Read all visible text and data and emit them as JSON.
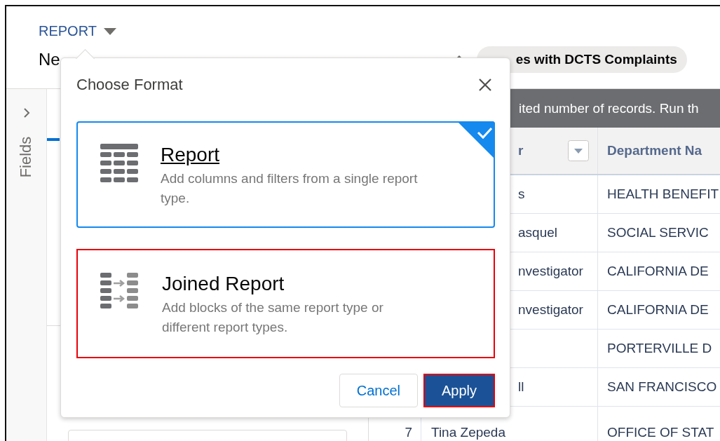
{
  "header": {
    "object_label": "REPORT",
    "title": "Ne",
    "pill": "es with DCTS Complaints"
  },
  "sidebar": {
    "label": "Fields"
  },
  "table": {
    "banner": "ited number of records. Run th",
    "columns": [
      {
        "label": "r"
      },
      {
        "label": "Department Na"
      }
    ],
    "rows": [
      {
        "name": "s",
        "partial": true,
        "department": "HEALTH BENEFIT"
      },
      {
        "name": "asquel",
        "partial": true,
        "department": "SOCIAL SERVIC"
      },
      {
        "name": "nvestigator",
        "partial": true,
        "department": "CALIFORNIA DE"
      },
      {
        "name": "nvestigator",
        "partial": true,
        "department": "CALIFORNIA DE"
      },
      {
        "department": "PORTERVILLE D"
      },
      {
        "name": "ll",
        "partial": true,
        "department": "SAN FRANCISCO"
      },
      {
        "number": "7",
        "name": "Tina Zepeda",
        "partial": false,
        "department": "OFFICE OF STAT"
      }
    ]
  },
  "dialog": {
    "title": "Choose Format",
    "options": [
      {
        "kind": "report",
        "title": "Report",
        "description": "Add columns and filters from a single report type.",
        "selected": true,
        "highlighted": false
      },
      {
        "kind": "joined",
        "title": "Joined Report",
        "description": "Add blocks of the same report type or different report types.",
        "selected": false,
        "highlighted": true
      }
    ],
    "buttons": [
      {
        "label": "Cancel",
        "kind": "neutral",
        "highlighted": false
      },
      {
        "label": "Apply",
        "kind": "brand",
        "highlighted": true
      }
    ]
  }
}
